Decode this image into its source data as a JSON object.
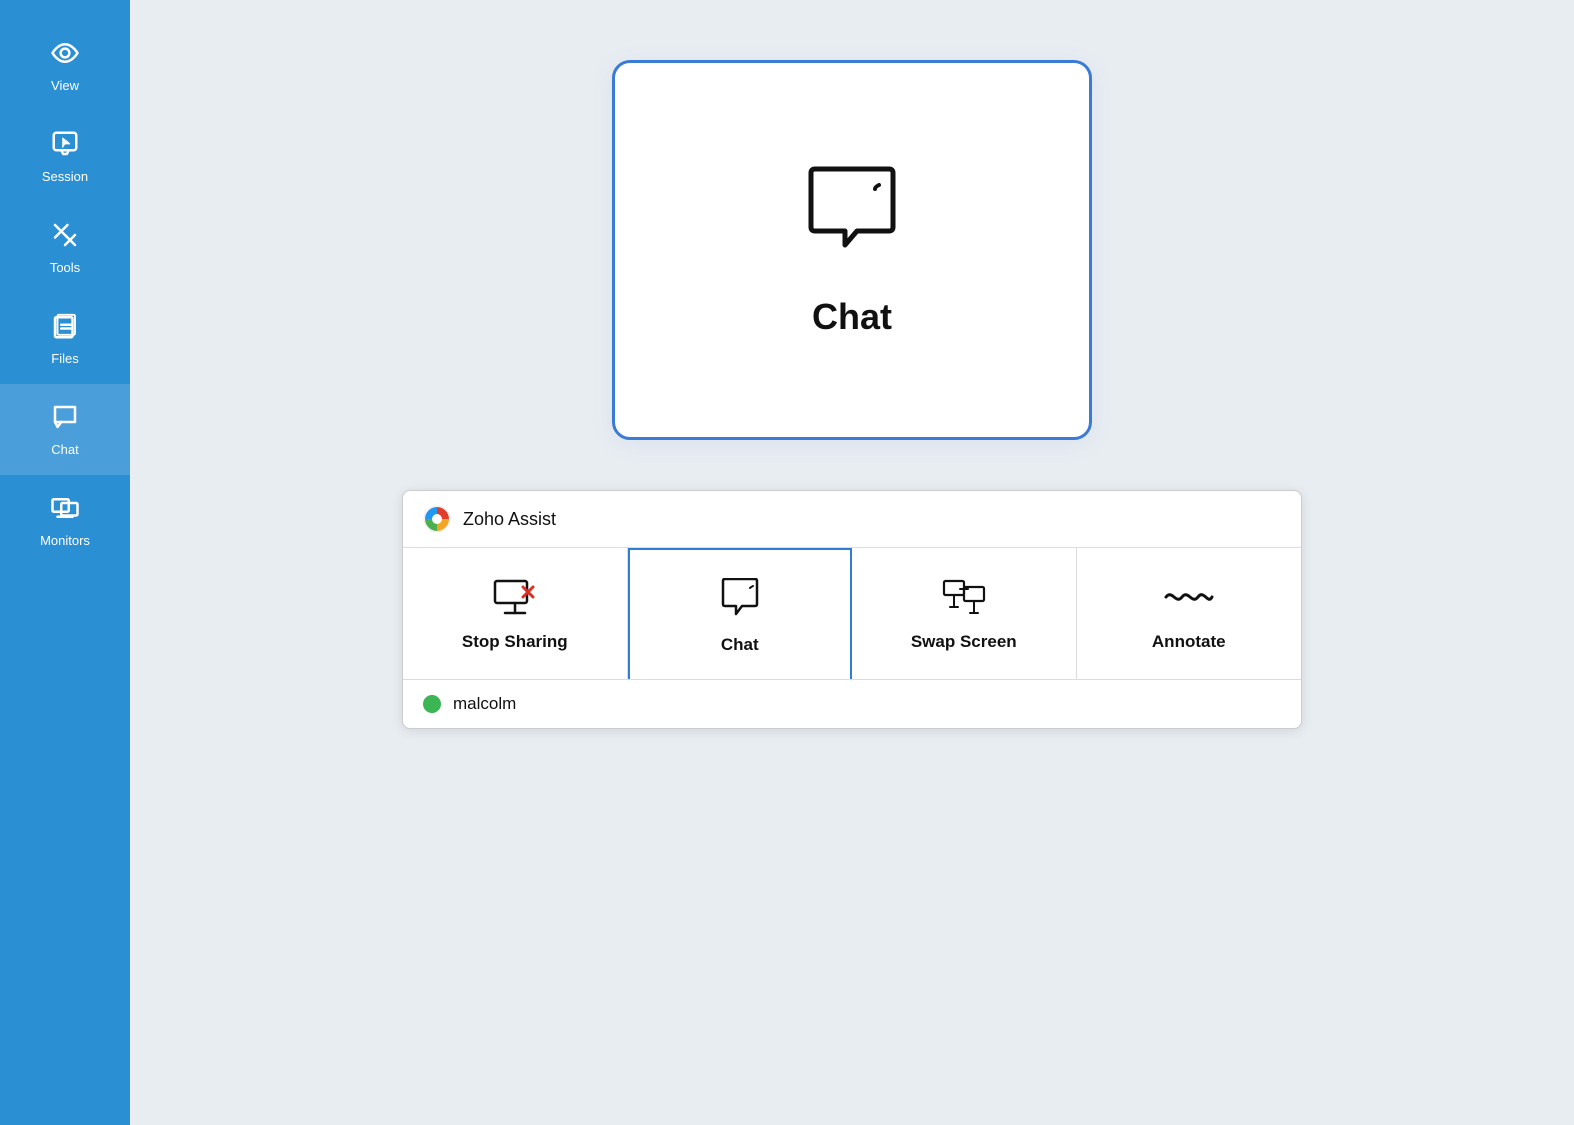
{
  "sidebar": {
    "items": [
      {
        "id": "view",
        "label": "View",
        "icon": "eye"
      },
      {
        "id": "session",
        "label": "Session",
        "icon": "cursor"
      },
      {
        "id": "tools",
        "label": "Tools",
        "icon": "tools"
      },
      {
        "id": "files",
        "label": "Files",
        "icon": "files"
      },
      {
        "id": "chat",
        "label": "Chat",
        "icon": "chat",
        "active": true
      },
      {
        "id": "monitors",
        "label": "Monitors",
        "icon": "monitors"
      }
    ]
  },
  "main": {
    "chat_card": {
      "label": "Chat"
    }
  },
  "zoho_panel": {
    "title": "Zoho Assist",
    "actions": [
      {
        "id": "stop-sharing",
        "label": "Stop Sharing",
        "icon": "stop-share",
        "active": false
      },
      {
        "id": "chat",
        "label": "Chat",
        "icon": "chat-bubble",
        "active": true
      },
      {
        "id": "swap-screen",
        "label": "Swap Screen",
        "icon": "swap-screen",
        "active": false
      },
      {
        "id": "annotate",
        "label": "Annotate",
        "icon": "annotate",
        "active": false
      }
    ],
    "user": {
      "name": "malcolm",
      "status": "online"
    }
  }
}
